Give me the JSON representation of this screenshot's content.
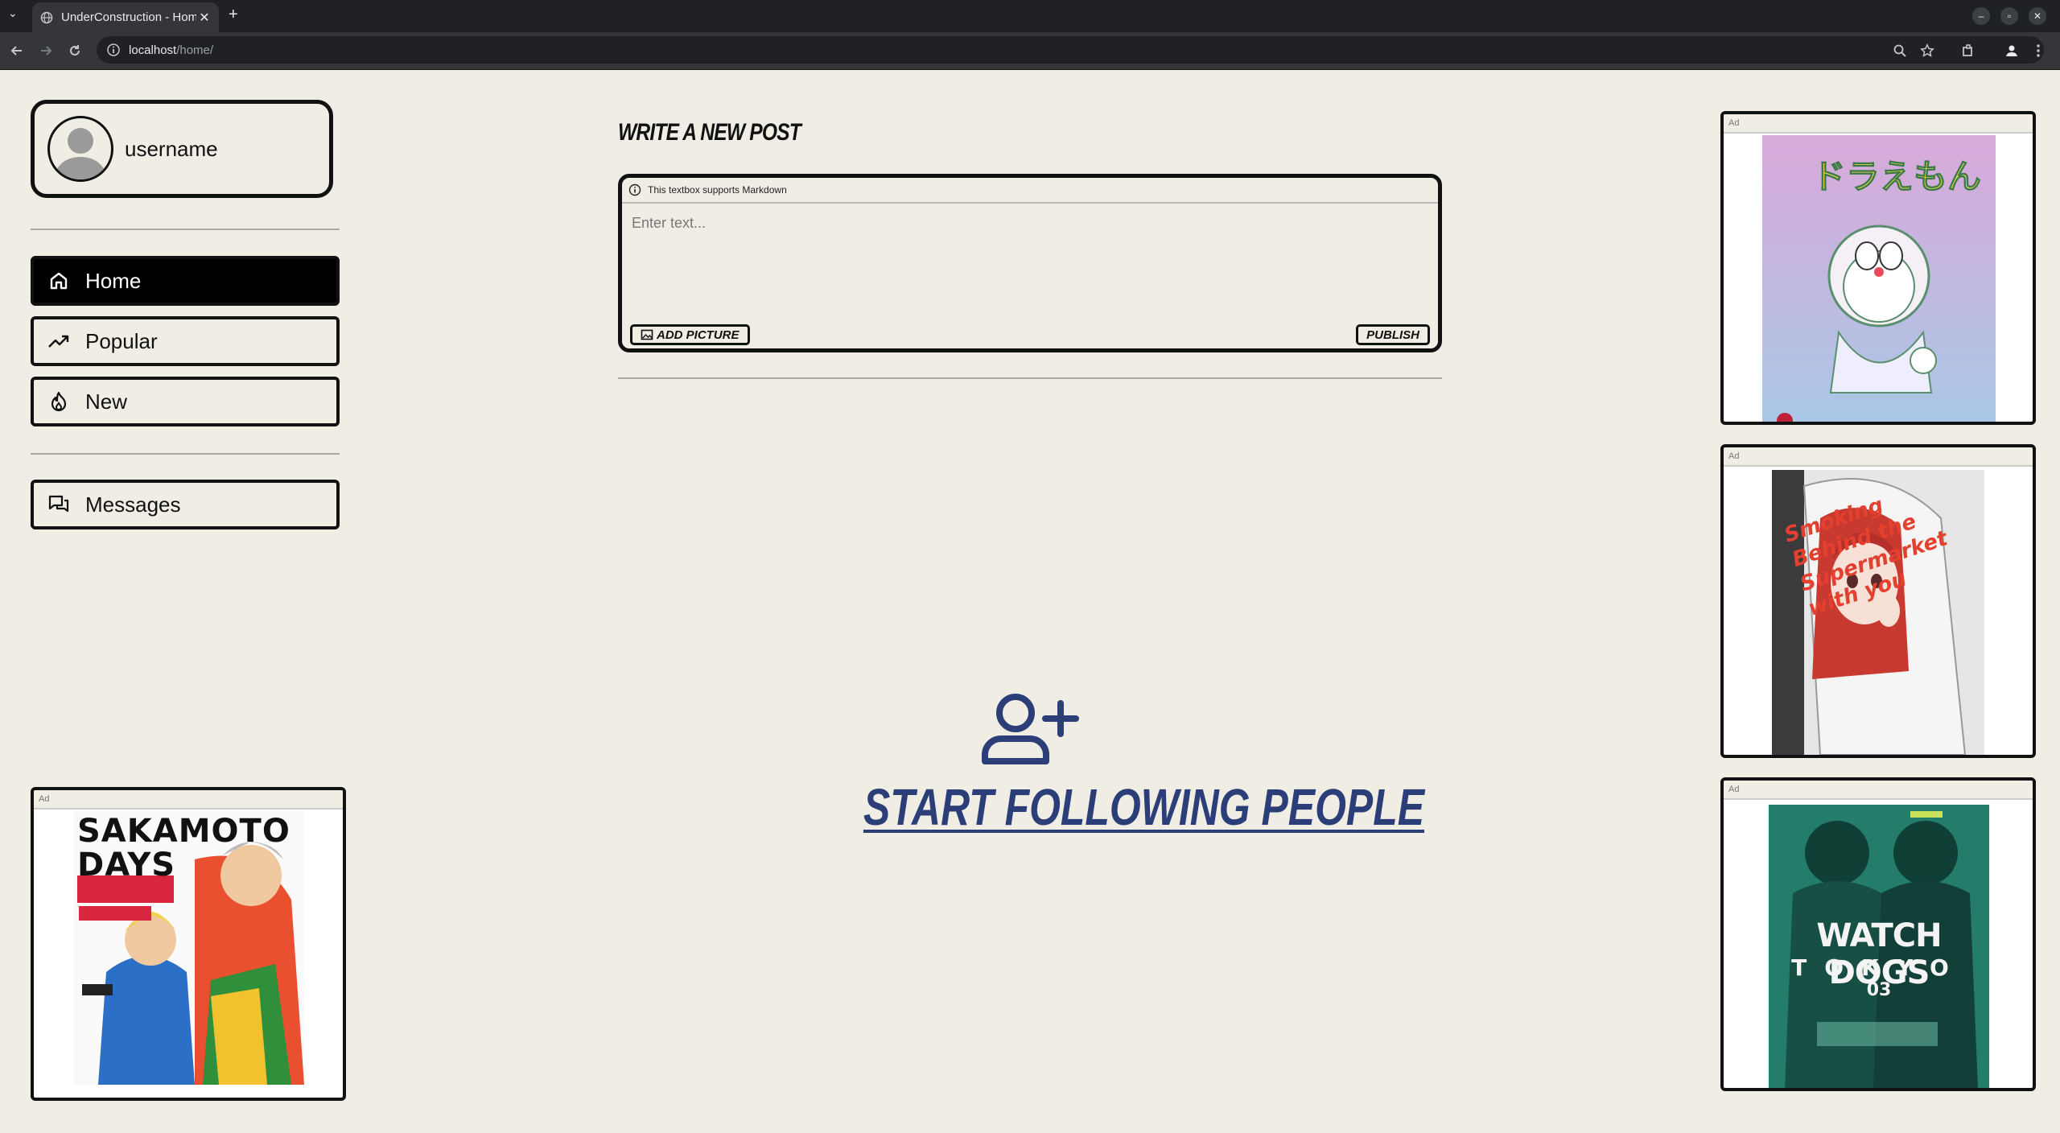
{
  "browser": {
    "tab_title": "UnderConstruction - Hom",
    "url_host": "localhost",
    "url_path": "/home/"
  },
  "profile": {
    "username": "username"
  },
  "nav": {
    "items": [
      {
        "label": "Home",
        "icon": "home-icon",
        "active": true
      },
      {
        "label": "Popular",
        "icon": "trending-icon",
        "active": false
      },
      {
        "label": "New",
        "icon": "fire-icon",
        "active": false
      }
    ],
    "messages_label": "Messages"
  },
  "composer": {
    "heading": "WRITE A NEW POST",
    "markdown_hint": "This textbox supports Markdown",
    "placeholder": "Enter text...",
    "add_picture_label": "ADD PICTURE",
    "publish_label": "PUBLISH"
  },
  "empty_state": {
    "text": "START FOLLOWING PEOPLE",
    "color": "#2c3e78"
  },
  "ads": {
    "label": "Ad",
    "left": {
      "cover_title": "SAKAMOTO DAYS"
    },
    "right": [
      {
        "cover_title": "ドラえもん"
      },
      {
        "cover_title": "Smoking Behind the Supermarket with you"
      },
      {
        "cover_title": "WATCH DOGS",
        "cover_subtitle": "TOKYO",
        "cover_number": "03"
      }
    ]
  }
}
